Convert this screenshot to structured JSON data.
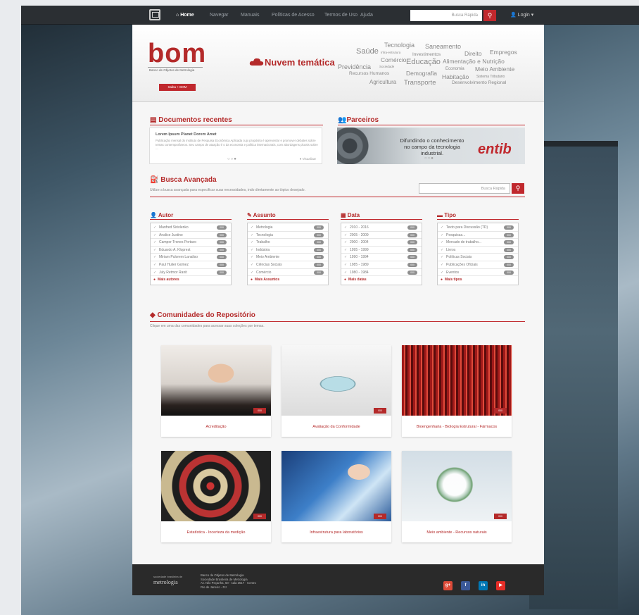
{
  "nav": {
    "home": "Home",
    "items": [
      "Navegar",
      "Manuais",
      "Políticas de Acesso",
      "Termos de Uso",
      "Ajuda"
    ],
    "search_placeholder": "Busca Rápida",
    "login": "Login"
  },
  "logo": {
    "text": "bom",
    "subtitle": "Banco de Objetos de Metrologia",
    "about_button": "Saiba + BOM"
  },
  "cloud": {
    "title": "Nuvem temática",
    "tags": [
      "Tecnologia",
      "Saneamento",
      "Saúde",
      "Infra-estrutura",
      "Investimentos",
      "Direito",
      "Empregos",
      "Comércio",
      "Educação",
      "Alimentação e Nutrição",
      "Previdência",
      "Sociedade",
      "Economia",
      "Meio Ambiente",
      "Recursos Humanos",
      "Demografia",
      "Habitação",
      "Sistema Tributário",
      "Agricultura",
      "Transporte",
      "Desenvolvimento Regional"
    ]
  },
  "docs": {
    "title": "Documentos recentes",
    "item_title": "Lorem Ipsum Planet Dorem Amet",
    "item_text": "Publicação mensal do Instituto de Pesquisa Econômica Aplicada cujo propósito é apresentar e promover debates sobre temas contemporâneos. Seu campo de atuação é o da economia e política internacionais, com abordagens plurais sobre ...",
    "view": "Visualizar"
  },
  "partners": {
    "title": "Parceiros",
    "line1": "Difundindo o conhecimento",
    "line2": "no campo da tecnologia industrial.",
    "brand": "entib"
  },
  "advanced": {
    "title": "Busca Avançada",
    "hint": "Utilize a busca avançada para especificar suas necessidades, indo diretamente ao tópico desejado.",
    "placeholder": "Busca Rápida"
  },
  "facets": [
    {
      "title": "Autor",
      "items": [
        "Manfred Siriolenko",
        "Analice Justino",
        "Camper Trones Portavo",
        "Eduardo A. Kloprest",
        "Miriam Pulorem Lanaliso",
        "Paul Hulier Gomez",
        "July Retmor Ranit"
      ],
      "more": "Mais autores"
    },
    {
      "title": "Assunto",
      "items": [
        "Metrologia",
        "Tecnologia",
        "Trabalho",
        "Indústria",
        "Meio Ambiente",
        "Ciências Sociais",
        "Comércio"
      ],
      "more": "Mais Assuntos"
    },
    {
      "title": "Data",
      "items": [
        "2010 - 2016",
        "2005 - 2009",
        "2000 - 2004",
        "1995 - 1999",
        "1990 - 1994",
        "1985 - 1989",
        "1980 - 1984"
      ],
      "more": "Mais datas"
    },
    {
      "title": "Tipo",
      "items": [
        "Texto para Discussão (TD)",
        "Pesquisas...",
        "Mercado de trabalho...",
        "Livros",
        "Políticas Sociais",
        "Publicações Oficiais",
        "Eventos"
      ],
      "more": "Mais tipos"
    }
  ],
  "facet_count": "000",
  "communities": {
    "title": "Comunidades do Repositório",
    "hint": "Clique em uma das comunidades para acessar suas coleções por temas.",
    "badge": "000",
    "items": [
      "Acreditação",
      "Avaliação da Conformidade",
      "Bioengenharia - Biologia Estrutural - Fármacos",
      "Estatística - Incerteza da medição",
      "Infraestrutura para laboratórios",
      "Meio ambiente - Recursos naturais"
    ]
  },
  "footer": {
    "logo_top": "sociedade brasileira de",
    "logo_main": "metrologia",
    "lines": [
      "Banco de Objetos de Metrologia",
      "Sociedade Brasileira de Metrologia",
      "Av. Nilo Peçanha, 50 - sala 2517 - Centro",
      "Rio de Janeiro - RJ"
    ],
    "social": [
      "g+",
      "f",
      "in",
      "▶"
    ]
  },
  "colors": {
    "accent": "#c0282d",
    "nav_bg": "#2b2f33",
    "footer_bg": "#2a2a2a",
    "google": "#dd4b39",
    "facebook": "#3b5998",
    "linkedin": "#0077b5",
    "youtube": "#e52d27"
  }
}
